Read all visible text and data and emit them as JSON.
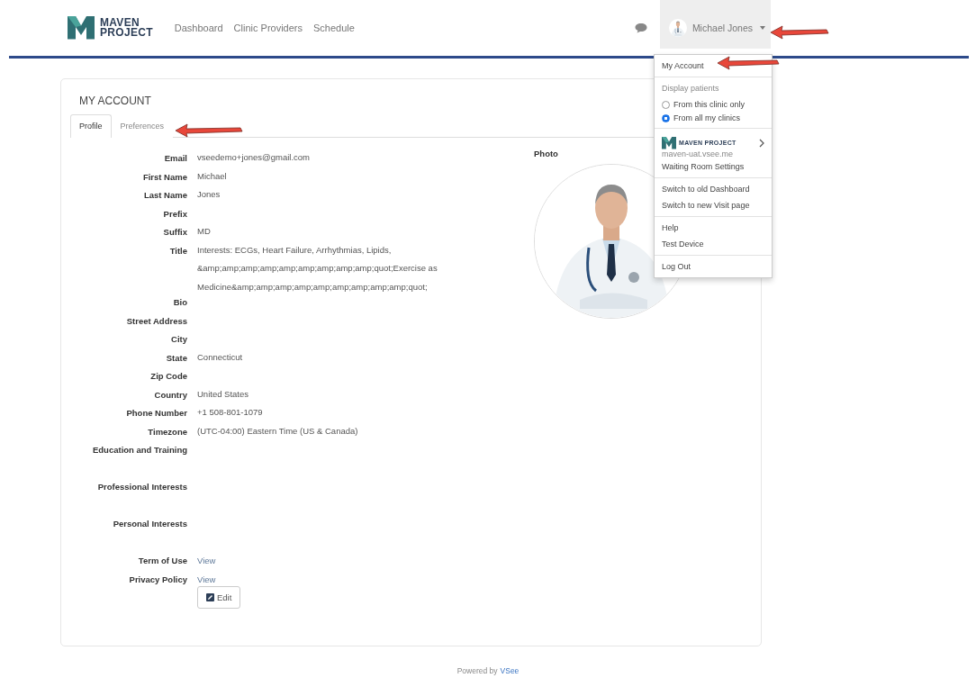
{
  "header": {
    "logo": {
      "line1": "MAVEN",
      "line2": "PROJECT"
    },
    "nav": [
      {
        "label": "Dashboard"
      },
      {
        "label": "Clinic Providers"
      },
      {
        "label": "Schedule"
      }
    ],
    "user": {
      "name": "Michael Jones",
      "expanded": true
    }
  },
  "user_menu": {
    "sections": [
      {
        "items": [
          {
            "kind": "link",
            "label": "My Account"
          }
        ]
      },
      {
        "items": [
          {
            "kind": "heading",
            "label": "Display patients"
          },
          {
            "kind": "radio",
            "label": "From this clinic only",
            "selected": false
          },
          {
            "kind": "radio",
            "label": "From all my clinics",
            "selected": true
          }
        ]
      },
      {
        "items": [
          {
            "kind": "logo",
            "label": "MAVEN PROJECT"
          },
          {
            "kind": "subtext",
            "label": "maven-uat.vsee.me"
          },
          {
            "kind": "link",
            "label": "Waiting Room Settings"
          }
        ]
      },
      {
        "items": [
          {
            "kind": "link",
            "label": "Switch to old Dashboard"
          },
          {
            "kind": "link",
            "label": "Switch to new Visit page"
          }
        ]
      },
      {
        "items": [
          {
            "kind": "link",
            "label": "Help"
          },
          {
            "kind": "link",
            "label": "Test Device"
          }
        ]
      },
      {
        "items": [
          {
            "kind": "link",
            "label": "Log Out"
          }
        ]
      }
    ]
  },
  "account": {
    "title": "MY ACCOUNT",
    "tabs": [
      {
        "label": "Profile",
        "selected": true
      },
      {
        "label": "Preferences",
        "selected": false
      }
    ],
    "fields": [
      {
        "kind": "text",
        "label": "Email",
        "value": "vseedemo+jones@gmail.com"
      },
      {
        "kind": "text",
        "label": "First Name",
        "value": "Michael"
      },
      {
        "kind": "text",
        "label": "Last Name",
        "value": "Jones"
      },
      {
        "kind": "text",
        "label": "Prefix"
      },
      {
        "kind": "text",
        "label": "Suffix",
        "value": "MD"
      },
      {
        "kind": "text",
        "label": "Title",
        "value": "Interests: ECGs, Heart Failure, Arrhythmias, Lipids, &amp;amp;amp;amp;amp;amp;amp;amp;amp;quot;Exercise as Medicine&amp;amp;amp;amp;amp;amp;amp;amp;amp;quot;"
      },
      {
        "kind": "text",
        "label": "Bio"
      },
      {
        "kind": "text",
        "label": "Street Address"
      },
      {
        "kind": "text",
        "label": "City"
      },
      {
        "kind": "text",
        "label": "State",
        "value": "Connecticut"
      },
      {
        "kind": "text",
        "label": "Zip Code"
      },
      {
        "kind": "text",
        "label": "Country",
        "value": "United States"
      },
      {
        "kind": "text",
        "label": "Phone Number",
        "value": "+1 508-801-1079"
      },
      {
        "kind": "text",
        "label": "Timezone",
        "value": "(UTC-04:00) Eastern Time (US & Canada)"
      },
      {
        "kind": "long",
        "label": "Education and Training"
      },
      {
        "kind": "long",
        "label": "Professional Interests"
      },
      {
        "kind": "long",
        "label": "Personal Interests"
      },
      {
        "kind": "link",
        "label": "Term of Use",
        "value": "View"
      },
      {
        "kind": "link",
        "label": "Privacy Policy",
        "value": "View"
      }
    ],
    "edit_button": "Edit",
    "photo": {
      "label": "Photo",
      "kind": "picture"
    }
  },
  "footer": {
    "text": "Powered by",
    "link": "VSee"
  }
}
